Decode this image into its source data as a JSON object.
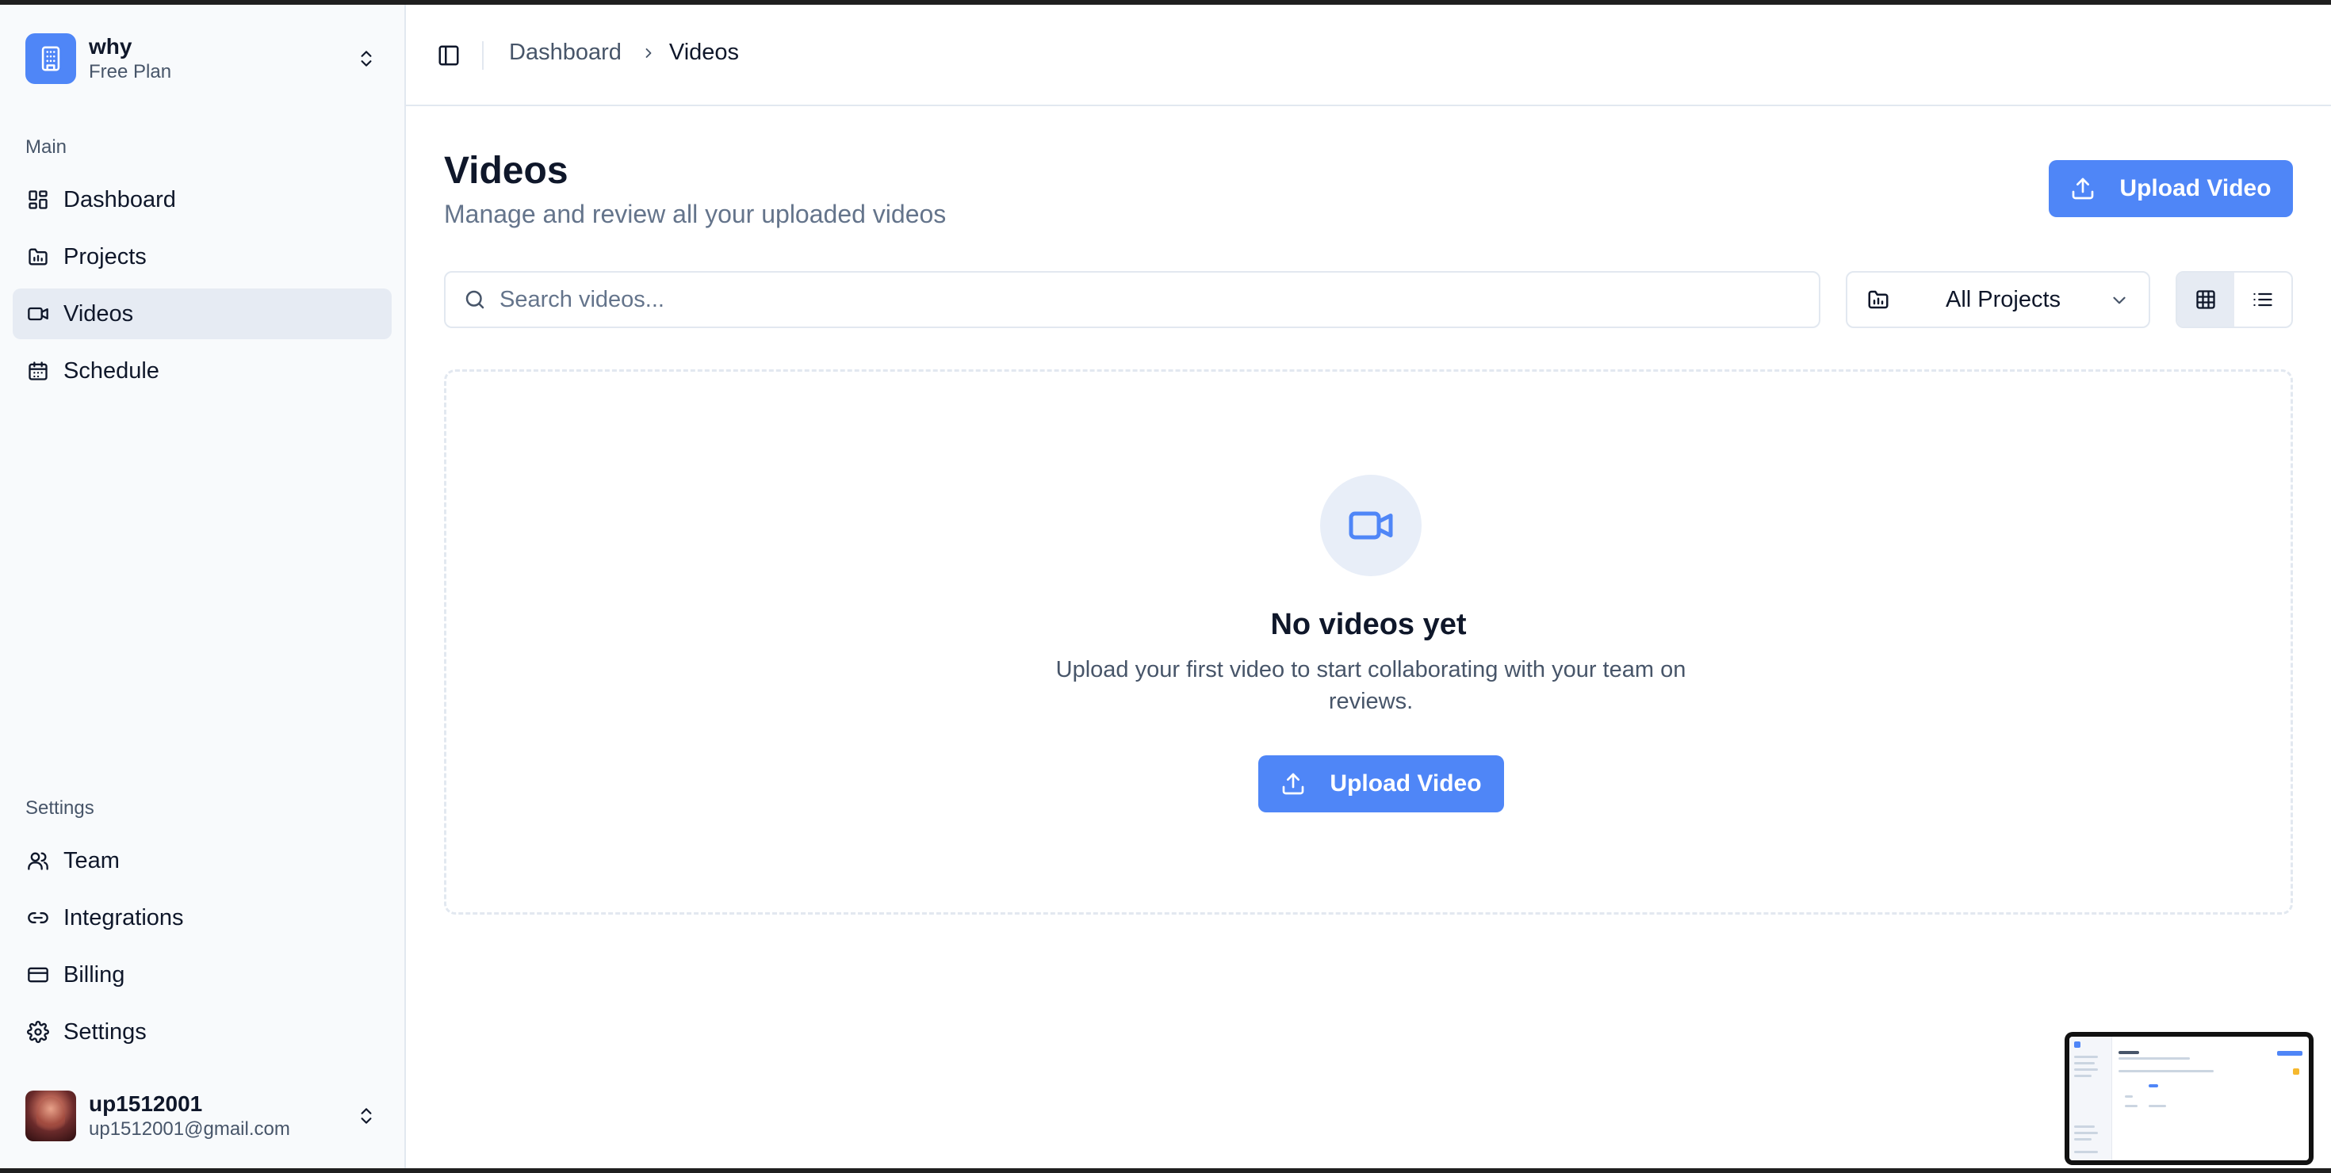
{
  "workspace": {
    "name": "why",
    "plan": "Free Plan"
  },
  "sidebar": {
    "main_label": "Main",
    "main_items": [
      {
        "label": "Dashboard",
        "icon": "dashboard-icon"
      },
      {
        "label": "Projects",
        "icon": "folder-icon"
      },
      {
        "label": "Videos",
        "icon": "video-icon",
        "active": true
      },
      {
        "label": "Schedule",
        "icon": "calendar-icon"
      }
    ],
    "settings_label": "Settings",
    "settings_items": [
      {
        "label": "Team",
        "icon": "users-icon"
      },
      {
        "label": "Integrations",
        "icon": "link-icon"
      },
      {
        "label": "Billing",
        "icon": "credit-card-icon"
      },
      {
        "label": "Settings",
        "icon": "gear-icon"
      }
    ]
  },
  "user": {
    "name": "up1512001",
    "email": "up1512001@gmail.com"
  },
  "breadcrumb": {
    "parent": "Dashboard",
    "current": "Videos"
  },
  "page": {
    "title": "Videos",
    "subtitle": "Manage and review all your uploaded videos",
    "upload_label": "Upload Video"
  },
  "search": {
    "placeholder": "Search videos...",
    "value": ""
  },
  "project_filter": {
    "selected": "All Projects"
  },
  "view_mode": {
    "active": "grid"
  },
  "empty_state": {
    "title": "No videos yet",
    "description": "Upload your first video to start collaborating with your team on reviews.",
    "button_label": "Upload Video"
  },
  "colors": {
    "accent": "#4f86f7",
    "active_bg": "#e6ebf3",
    "border": "#e2e8f0"
  }
}
